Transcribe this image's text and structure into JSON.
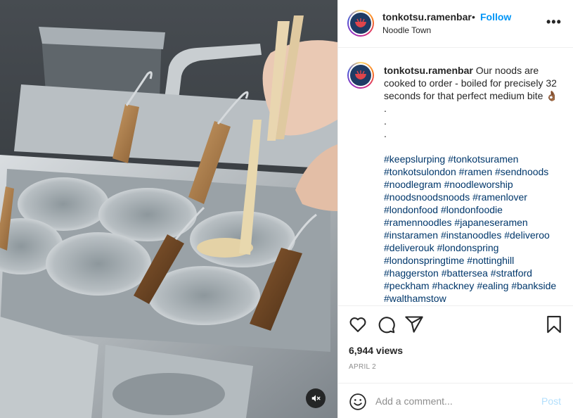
{
  "post": {
    "username": "tonkotsu.ramenbar",
    "separator": "•",
    "follow_label": "Follow",
    "location": "Noodle Town",
    "more_label": "•••"
  },
  "caption": {
    "username": "tonkotsu.ramenbar",
    "text": "Our noods are cooked to order - boiled for precisely 32 seconds for that perfect medium bite 👌🏾",
    "dots": [
      ".",
      ".",
      "."
    ],
    "hashtags": [
      "#keepslurping",
      "#tonkotsuramen",
      "#tonkotsulondon",
      "#ramen",
      "#sendnoods",
      "#noodlegram",
      "#noodleworship",
      "#noodsnoodsnoods",
      "#ramenlover",
      "#londonfood",
      "#londonfoodie",
      "#ramennoodles",
      "#japaneseramen",
      "#instaramen",
      "#instanoodles",
      "#deliveroo",
      "#deliverouk",
      "#londonspring",
      "#londonspringtime",
      "#nottinghill",
      "#haggerston",
      "#battersea",
      "#stratford",
      "#peckham",
      "#hackney",
      "#ealing",
      "#bankside",
      "#walthamstow"
    ]
  },
  "stats": {
    "views": "6,944 views",
    "date": "APRIL 2"
  },
  "comment_box": {
    "placeholder": "Add a comment...",
    "post_label": "Post"
  },
  "icons": {
    "like": "heart-icon",
    "comment": "comment-icon",
    "share": "share-icon",
    "save": "bookmark-icon",
    "emoji": "emoji-icon",
    "mute": "speaker-muted-icon",
    "more": "more-options-icon"
  },
  "colors": {
    "link_blue": "#0095f6",
    "hashtag": "#00376b",
    "post_disabled": "#b2dffc",
    "secondary_text": "#8e8e8e"
  }
}
